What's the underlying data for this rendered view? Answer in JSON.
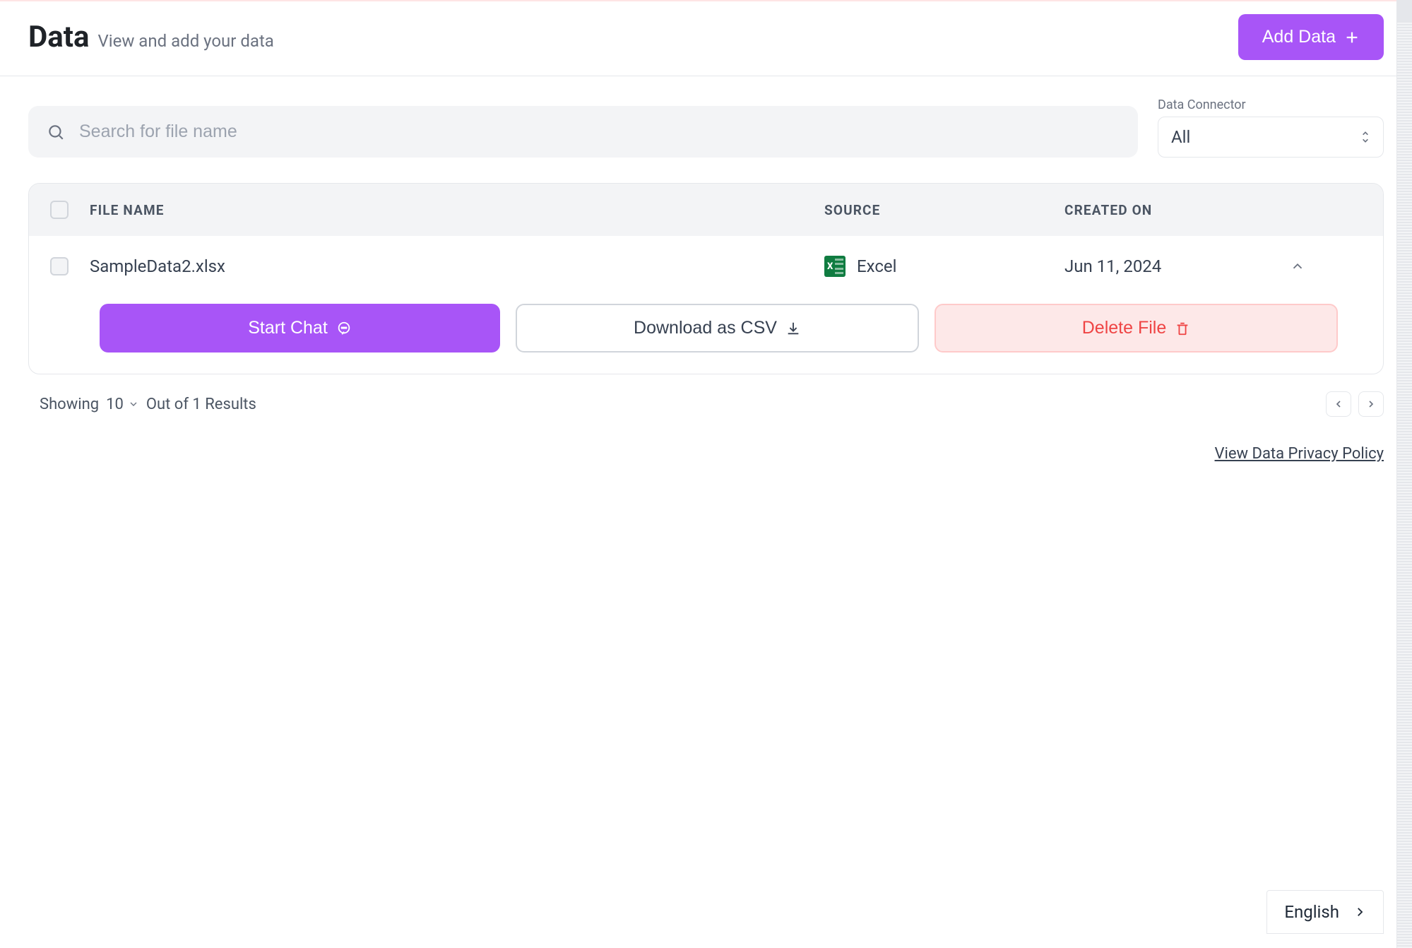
{
  "header": {
    "title": "Data",
    "subtitle": "View and add your data",
    "add_button": "Add Data"
  },
  "search": {
    "placeholder": "Search for file name"
  },
  "connector": {
    "label": "Data Connector",
    "value": "All"
  },
  "table": {
    "columns": {
      "file_name": "FILE NAME",
      "source": "SOURCE",
      "created_on": "CREATED ON"
    },
    "rows": [
      {
        "file_name": "SampleData2.xlsx",
        "source": "Excel",
        "created_on": "Jun 11, 2024"
      }
    ]
  },
  "row_actions": {
    "start_chat": "Start Chat",
    "download_csv": "Download as CSV",
    "delete_file": "Delete File"
  },
  "pagination": {
    "showing_label": "Showing",
    "page_size": "10",
    "results_label": "Out of 1 Results"
  },
  "footer": {
    "privacy_link": "View Data Privacy Policy",
    "language": "English"
  }
}
